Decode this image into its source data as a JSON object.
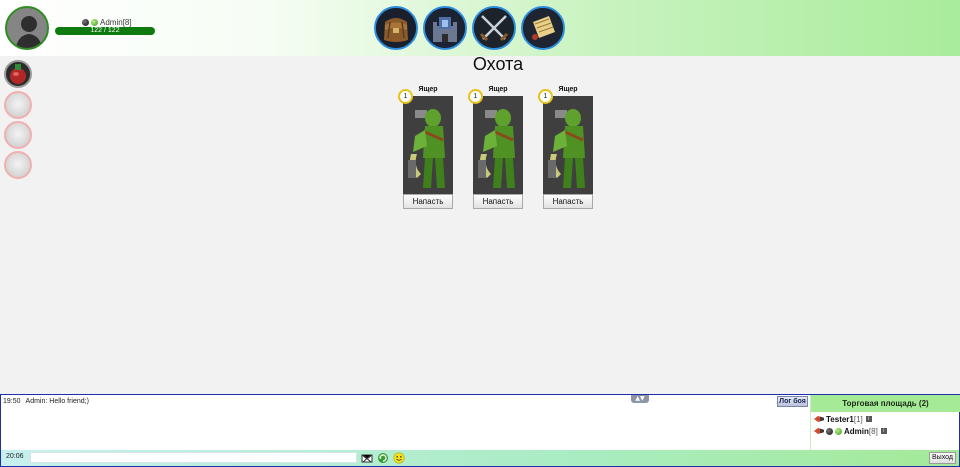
{
  "colors": {
    "accent_green": "#a4ea97",
    "hp_bar": "#0f7a0f",
    "nav_border": "#2a8de0",
    "level_ring": "#e8c21a"
  },
  "player": {
    "name": "Admin",
    "level": "[8]",
    "hp_text": "122 / 122",
    "hp_fraction": 1.0
  },
  "nav": [
    {
      "icon": "backpack-icon"
    },
    {
      "icon": "castle-icon"
    },
    {
      "icon": "crossed-swords-icon"
    },
    {
      "icon": "scroll-icon"
    }
  ],
  "slots": [
    "potion-slot",
    "empty-slot",
    "empty-slot",
    "empty-slot"
  ],
  "main": {
    "title": "Охота"
  },
  "monsters": [
    {
      "name": "Ящер",
      "level": "1",
      "attack_label": "Напасть",
      "icon": "lizard-warrior-icon"
    },
    {
      "name": "Ящер",
      "level": "1",
      "attack_label": "Напасть",
      "icon": "lizard-warrior-icon"
    },
    {
      "name": "Ящер",
      "level": "1",
      "attack_label": "Напасть",
      "icon": "lizard-warrior-icon"
    }
  ],
  "chat": {
    "messages": [
      {
        "time": "19:50",
        "text": "Admin: Hello friend;)"
      }
    ],
    "battle_log_label": "Лог боя",
    "room_title": "Торговая площадь (2)",
    "users": [
      {
        "name": "Tester1",
        "level": "[1]"
      },
      {
        "name": "Admin",
        "level": "[8]"
      }
    ],
    "current_time": "20:06",
    "input_value": "",
    "exit_label": "Выход"
  }
}
